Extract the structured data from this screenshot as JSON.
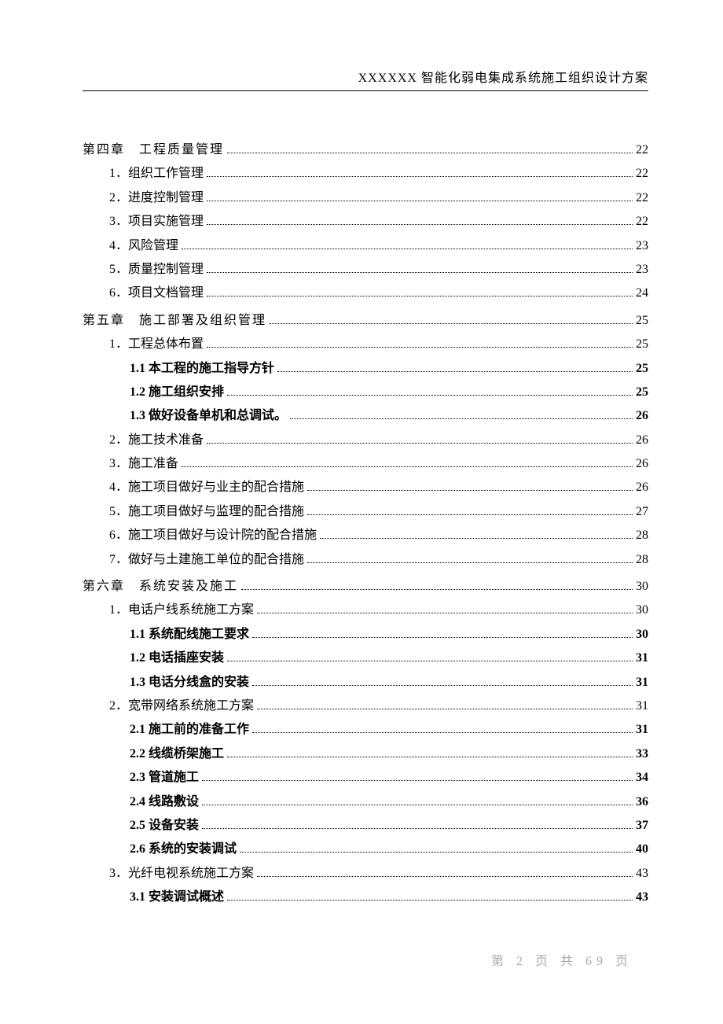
{
  "header": "XXXXXX 智能化弱电集成系统施工组织设计方案",
  "footer": "第 2 页 共 69 页",
  "toc": [
    {
      "label": "第四章　工程质量管理",
      "page": "22",
      "indent": 0,
      "cls": "chapter"
    },
    {
      "label": "1．组织工作管理",
      "page": "22",
      "indent": 1,
      "cls": ""
    },
    {
      "label": "2．进度控制管理",
      "page": "22",
      "indent": 1,
      "cls": ""
    },
    {
      "label": "3．项目实施管理",
      "page": "22",
      "indent": 1,
      "cls": ""
    },
    {
      "label": "4．风险管理",
      "page": "23",
      "indent": 1,
      "cls": ""
    },
    {
      "label": "5．质量控制管理",
      "page": "23",
      "indent": 1,
      "cls": ""
    },
    {
      "label": "6．项目文档管理",
      "page": "24",
      "indent": 1,
      "cls": ""
    },
    {
      "label": "第五章　施工部署及组织管理",
      "page": "25",
      "indent": 0,
      "cls": "chapter"
    },
    {
      "label": "1．工程总体布置",
      "page": "25",
      "indent": 1,
      "cls": ""
    },
    {
      "label": "1.1 本工程的施工指导方针",
      "page": "25",
      "indent": 2,
      "cls": "bold"
    },
    {
      "label": "1.2 施工组织安排",
      "page": "25",
      "indent": 2,
      "cls": "bold"
    },
    {
      "label": "1.3 做好设备单机和总调试。",
      "page": "26",
      "indent": 2,
      "cls": "bold"
    },
    {
      "label": "2．施工技术准备",
      "page": "26",
      "indent": 1,
      "cls": ""
    },
    {
      "label": "3．施工准备",
      "page": "26",
      "indent": 1,
      "cls": ""
    },
    {
      "label": "4．施工项目做好与业主的配合措施",
      "page": "26",
      "indent": 1,
      "cls": ""
    },
    {
      "label": "5．施工项目做好与监理的配合措施",
      "page": "27",
      "indent": 1,
      "cls": ""
    },
    {
      "label": "6．施工项目做好与设计院的配合措施",
      "page": "28",
      "indent": 1,
      "cls": ""
    },
    {
      "label": "7．做好与土建施工单位的配合措施",
      "page": "28",
      "indent": 1,
      "cls": ""
    },
    {
      "label": "第六章　系统安装及施工",
      "page": "30",
      "indent": 0,
      "cls": "chapter"
    },
    {
      "label": "1．电话户线系统施工方案",
      "page": "30",
      "indent": 1,
      "cls": ""
    },
    {
      "label": "1.1 系统配线施工要求",
      "page": "30",
      "indent": 2,
      "cls": "bold"
    },
    {
      "label": "1.2 电话插座安装",
      "page": "31",
      "indent": 2,
      "cls": "bold"
    },
    {
      "label": "1.3 电话分线盒的安装",
      "page": "31",
      "indent": 2,
      "cls": "bold"
    },
    {
      "label": "2．宽带网络系统施工方案",
      "page": "31",
      "indent": 1,
      "cls": ""
    },
    {
      "label": "2.1 施工前的准备工作",
      "page": "31",
      "indent": 2,
      "cls": "bold"
    },
    {
      "label": "2.2 线缆桥架施工",
      "page": "33",
      "indent": 2,
      "cls": "bold"
    },
    {
      "label": "2.3 管道施工",
      "page": "34",
      "indent": 2,
      "cls": "bold"
    },
    {
      "label": "2.4 线路敷设",
      "page": "36",
      "indent": 2,
      "cls": "bold"
    },
    {
      "label": "2.5 设备安装",
      "page": "37",
      "indent": 2,
      "cls": "bold"
    },
    {
      "label": "2.6 系统的安装调试",
      "page": "40",
      "indent": 2,
      "cls": "bold"
    },
    {
      "label": "3．光纤电视系统施工方案",
      "page": "43",
      "indent": 1,
      "cls": ""
    },
    {
      "label": "3.1 安装调试概述",
      "page": "43",
      "indent": 2,
      "cls": "bold"
    }
  ]
}
